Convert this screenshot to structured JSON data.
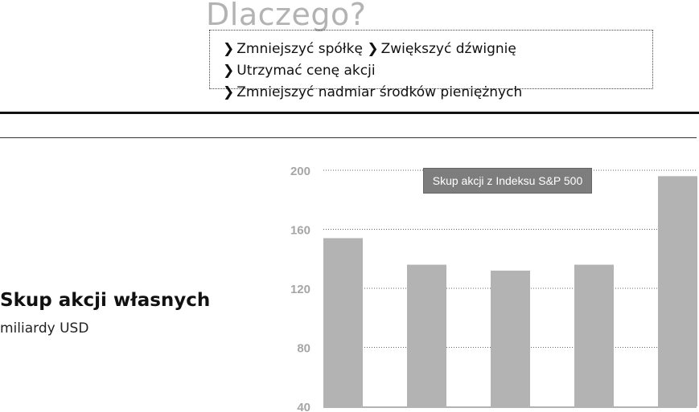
{
  "header": {
    "title": "Dlaczego?",
    "reasons": [
      "Zmniejszyć spółkę",
      "Zwiększyć dźwignię",
      "Utrzymać cenę akcji",
      "Zmniejszyć nadmiar środków pieniężnych"
    ],
    "arrow_glyph": "❯"
  },
  "chart_data": {
    "type": "bar",
    "title": "Skup akcji własnych",
    "subtitle": "miliardy USD",
    "legend": "Skup akcji z Indeksu S&P 500",
    "y_ticks": [
      200,
      160,
      120,
      80,
      40
    ],
    "ylim": [
      40,
      200
    ],
    "grid": true,
    "values": [
      154,
      136,
      132,
      136,
      196
    ],
    "colors": {
      "bar": "#b3b3b3",
      "tick": "#a6a6a6",
      "grid": "#666666",
      "legend_bg": "#7d7d7d"
    }
  }
}
